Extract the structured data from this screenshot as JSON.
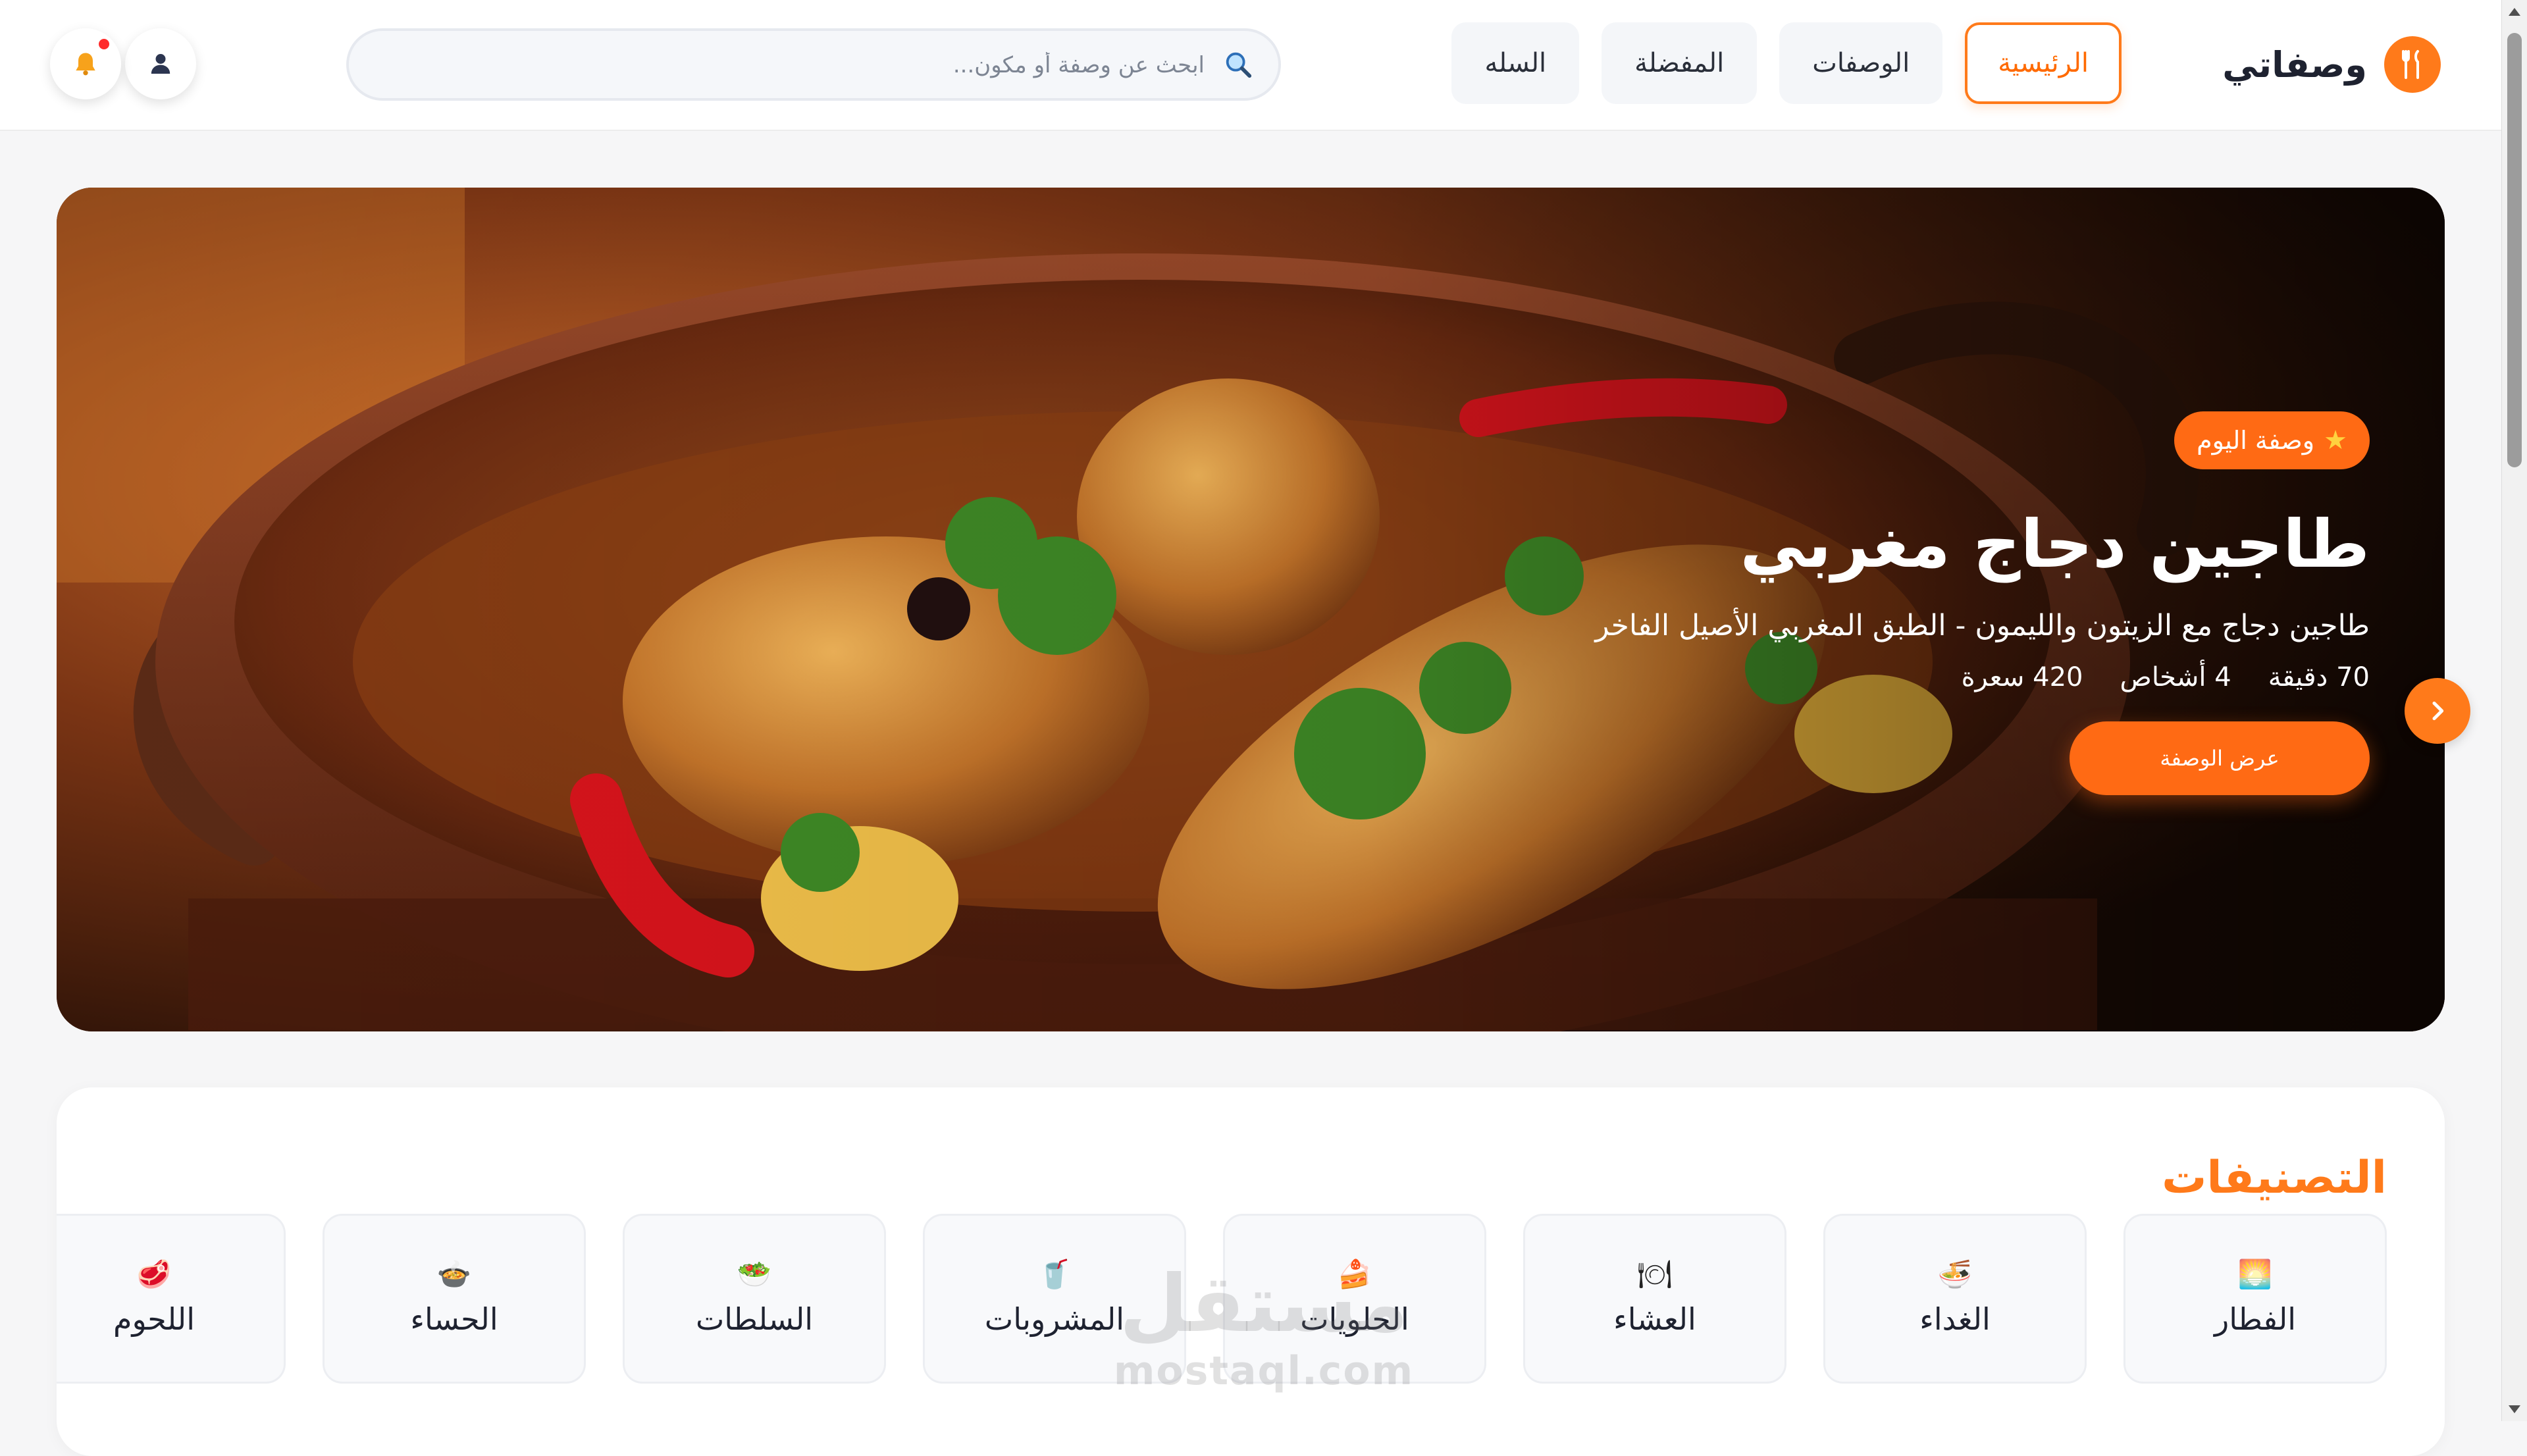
{
  "brand": {
    "name": "وصفاتي",
    "icon": "utensils-icon",
    "accent": "#ff7a1a"
  },
  "nav": {
    "items": [
      {
        "label": "الرئيسية",
        "active": true
      },
      {
        "label": "الوصفات",
        "active": false
      },
      {
        "label": "المفضلة",
        "active": false
      },
      {
        "label": "السله",
        "active": false
      }
    ]
  },
  "search": {
    "placeholder": "ابحث عن وصفة أو مكون...",
    "value": ""
  },
  "header_actions": {
    "profile_icon": "user-icon",
    "notification_icon": "bell-icon",
    "has_unread": true
  },
  "hero": {
    "badge": "وصفة اليوم",
    "title": "طاجين دجاج مغربي",
    "description": "طاجين دجاج مع الزيتون والليمون - الطبق المغربي الأصيل الفاخر",
    "meta": {
      "time": "70 دقيقة",
      "servings": "4 أشخاص",
      "calories": "420 سعرة"
    },
    "cta": "عرض الوصفة",
    "next_icon": "chevron-right-icon"
  },
  "categories": {
    "title": "التصنيفات",
    "items": [
      {
        "label": "الفطار",
        "icon": "🌅"
      },
      {
        "label": "الغداء",
        "icon": "🍜"
      },
      {
        "label": "العشاء",
        "icon": "🍽"
      },
      {
        "label": "الحلويات",
        "icon": "🍰"
      },
      {
        "label": "المشروبات",
        "icon": "🥤"
      },
      {
        "label": "السلطات",
        "icon": "🥗"
      },
      {
        "label": "الحساء",
        "icon": "🍲"
      },
      {
        "label": "اللحوم",
        "icon": "🥩"
      }
    ]
  },
  "watermark": {
    "arabic": "مستقل",
    "latin": "mostaql.com"
  }
}
